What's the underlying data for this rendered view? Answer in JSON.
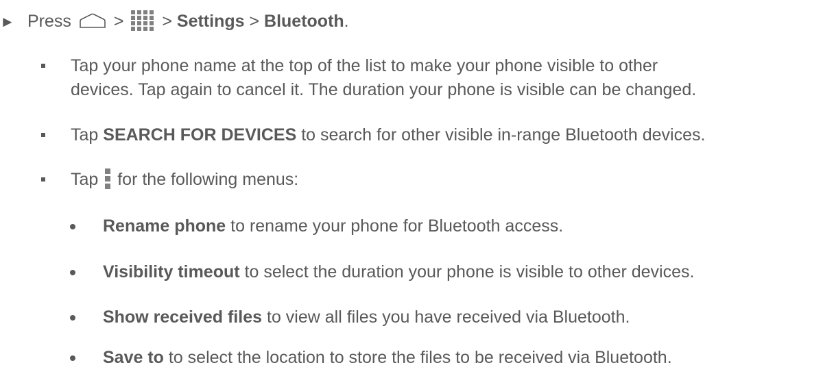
{
  "step": {
    "marker": "►",
    "press": "Press",
    "sep1": ">",
    "sep2": ">",
    "settings": "Settings",
    "sep3": ">",
    "bluetooth": "Bluetooth",
    "period": ".",
    "icons": [
      "home-icon",
      "apps-icon"
    ]
  },
  "bullets": {
    "b1_line1": "Tap your phone name at the top of the list to make your phone visible to other",
    "b1_line2": "devices. Tap again to cancel it. The duration your phone is visible can be changed.",
    "b2_pre": "Tap",
    "b2_bold": "SEARCH FOR DEVICES",
    "b2_post": "to search for other visible in-range Bluetooth devices.",
    "b3_pre": "Tap",
    "b3_post": "for the following menus:",
    "b3_icon": "menu-icon"
  },
  "menus": [
    {
      "bold": "Rename phone",
      "text": "to rename your phone for Bluetooth access."
    },
    {
      "bold": "Visibility timeout",
      "text": "to select the duration your phone is visible to other devices."
    },
    {
      "bold": "Show received files",
      "text": "to view all files you have received via Bluetooth."
    },
    {
      "bold": "Save to",
      "text": "to select the location to store the files to be received via Bluetooth."
    }
  ]
}
